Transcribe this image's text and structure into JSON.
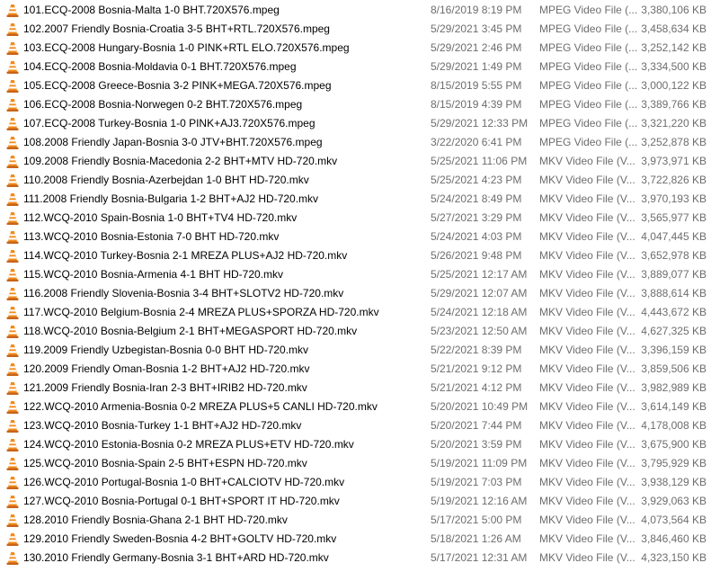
{
  "files": [
    {
      "name": "101.ECQ-2008 Bosnia-Malta 1-0 BHT.720X576.mpeg",
      "date": "8/16/2019 8:19 PM",
      "type": "MPEG Video File (...",
      "size": "3,380,106 KB"
    },
    {
      "name": "102.2007 Friendly Bosnia-Croatia 3-5 BHT+RTL.720X576.mpeg",
      "date": "5/29/2021 3:45 PM",
      "type": "MPEG Video File (...",
      "size": "3,458,634 KB"
    },
    {
      "name": "103.ECQ-2008 Hungary-Bosnia 1-0 PINK+RTL ELO.720X576.mpeg",
      "date": "5/29/2021 2:46 PM",
      "type": "MPEG Video File (...",
      "size": "3,252,142 KB"
    },
    {
      "name": "104.ECQ-2008 Bosnia-Moldavia 0-1 BHT.720X576.mpeg",
      "date": "5/29/2021 1:49 PM",
      "type": "MPEG Video File (...",
      "size": "3,334,500 KB"
    },
    {
      "name": "105.ECQ-2008 Greece-Bosnia 3-2  PINK+MEGA.720X576.mpeg",
      "date": "8/15/2019 5:55 PM",
      "type": "MPEG Video File (...",
      "size": "3,000,122 KB"
    },
    {
      "name": "106.ECQ-2008 Bosnia-Norwegen 0-2 BHT.720X576.mpeg",
      "date": "8/15/2019 4:39 PM",
      "type": "MPEG Video File (...",
      "size": "3,389,766 KB"
    },
    {
      "name": "107.ECQ-2008 Turkey-Bosnia 1-0 PINK+AJ3.720X576.mpeg",
      "date": "5/29/2021 12:33 PM",
      "type": "MPEG Video File (...",
      "size": "3,321,220 KB"
    },
    {
      "name": "108.2008 Friendly Japan-Bosnia 3-0 JTV+BHT.720X576.mpeg",
      "date": "3/22/2020 6:41 PM",
      "type": "MPEG Video File (...",
      "size": "3,252,878 KB"
    },
    {
      "name": "109.2008 Friendly Bosnia-Macedonia 2-2 BHT+MTV HD-720.mkv",
      "date": "5/25/2021 11:06 PM",
      "type": "MKV Video File (V...",
      "size": "3,973,971 KB"
    },
    {
      "name": "110.2008 Friendly Bosnia-Azerbejdan 1-0 BHT HD-720.mkv",
      "date": "5/25/2021 4:23 PM",
      "type": "MKV Video File (V...",
      "size": "3,722,826 KB"
    },
    {
      "name": "111.2008 Friendly Bosnia-Bulgaria 1-2 BHT+AJ2 HD-720.mkv",
      "date": "5/24/2021 8:49 PM",
      "type": "MKV Video File (V...",
      "size": "3,970,193 KB"
    },
    {
      "name": "112.WCQ-2010 Spain-Bosnia 1-0 BHT+TV4 HD-720.mkv",
      "date": "5/27/2021 3:29 PM",
      "type": "MKV Video File (V...",
      "size": "3,565,977 KB"
    },
    {
      "name": "113.WCQ-2010 Bosnia-Estonia 7-0 BHT HD-720.mkv",
      "date": "5/24/2021 4:03 PM",
      "type": "MKV Video File (V...",
      "size": "4,047,445 KB"
    },
    {
      "name": "114.WCQ-2010 Turkey-Bosnia 2-1 MREZA PLUS+AJ2 HD-720.mkv",
      "date": "5/26/2021 9:48 PM",
      "type": "MKV Video File (V...",
      "size": "3,652,978 KB"
    },
    {
      "name": "115.WCQ-2010 Bosnia-Armenia 4-1 BHT HD-720.mkv",
      "date": "5/25/2021 12:17 AM",
      "type": "MKV Video File (V...",
      "size": "3,889,077 KB"
    },
    {
      "name": "116.2008 Friendly Slovenia-Bosnia 3-4 BHT+SLOTV2 HD-720.mkv",
      "date": "5/29/2021 12:07 AM",
      "type": "MKV Video File (V...",
      "size": "3,888,614 KB"
    },
    {
      "name": "117.WCQ-2010 Belgium-Bosnia 2-4 MREZA PLUS+SPORZA HD-720.mkv",
      "date": "5/24/2021 12:18 AM",
      "type": "MKV Video File (V...",
      "size": "4,443,672 KB"
    },
    {
      "name": "118.WCQ-2010 Bosnia-Belgium 2-1 BHT+MEGASPORT HD-720.mkv",
      "date": "5/23/2021 12:50 AM",
      "type": "MKV Video File (V...",
      "size": "4,627,325 KB"
    },
    {
      "name": "119.2009 Friendly Uzbegistan-Bosnia 0-0 BHT HD-720.mkv",
      "date": "5/22/2021 8:39 PM",
      "type": "MKV Video File (V...",
      "size": "3,396,159 KB"
    },
    {
      "name": "120.2009 Friendly Oman-Bosnia 1-2 BHT+AJ2 HD-720.mkv",
      "date": "5/21/2021 9:12 PM",
      "type": "MKV Video File (V...",
      "size": "3,859,506 KB"
    },
    {
      "name": "121.2009 Friendly Bosnia-Iran 2-3 BHT+IRIB2 HD-720.mkv",
      "date": "5/21/2021 4:12 PM",
      "type": "MKV Video File (V...",
      "size": "3,982,989 KB"
    },
    {
      "name": "122.WCQ-2010 Armenia-Bosnia 0-2 MREZA PLUS+5 CANLI HD-720.mkv",
      "date": "5/20/2021 10:49 PM",
      "type": "MKV Video File (V...",
      "size": "3,614,149 KB"
    },
    {
      "name": "123.WCQ-2010 Bosnia-Turkey 1-1 BHT+AJ2 HD-720.mkv",
      "date": "5/20/2021 7:44 PM",
      "type": "MKV Video File (V...",
      "size": "4,178,008 KB"
    },
    {
      "name": "124.WCQ-2010 Estonia-Bosnia 0-2 MREZA PLUS+ETV HD-720.mkv",
      "date": "5/20/2021 3:59 PM",
      "type": "MKV Video File (V...",
      "size": "3,675,900 KB"
    },
    {
      "name": "125.WCQ-2010 Bosnia-Spain 2-5 BHT+ESPN HD-720.mkv",
      "date": "5/19/2021 11:09 PM",
      "type": "MKV Video File (V...",
      "size": "3,795,929 KB"
    },
    {
      "name": "126.WCQ-2010 Portugal-Bosnia 1-0  BHT+CALCIOTV HD-720.mkv",
      "date": "5/19/2021 7:03 PM",
      "type": "MKV Video File (V...",
      "size": "3,938,129 KB"
    },
    {
      "name": "127.WCQ-2010 Bosnia-Portugal 0-1 BHT+SPORT IT HD-720.mkv",
      "date": "5/19/2021 12:16 AM",
      "type": "MKV Video File (V...",
      "size": "3,929,063 KB"
    },
    {
      "name": "128.2010 Friendly Bosnia-Ghana 2-1 BHT HD-720.mkv",
      "date": "5/17/2021 5:00 PM",
      "type": "MKV Video File (V...",
      "size": "4,073,564 KB"
    },
    {
      "name": "129.2010 Friendly Sweden-Bosnia 4-2 BHT+GOLTV HD-720.mkv",
      "date": "5/18/2021 1:26 AM",
      "type": "MKV Video File (V...",
      "size": "3,846,460 KB"
    },
    {
      "name": "130.2010 Friendly Germany-Bosnia 3-1 BHT+ARD HD-720.mkv",
      "date": "5/17/2021 12:31 AM",
      "type": "MKV Video File (V...",
      "size": "4,323,150 KB"
    }
  ],
  "icon": "vlc-cone-icon",
  "colors": {
    "cone_orange": "#f28c1c",
    "cone_stripe": "#ffffff",
    "base": "#c8641a",
    "meta_text": "#6d6d6d"
  }
}
